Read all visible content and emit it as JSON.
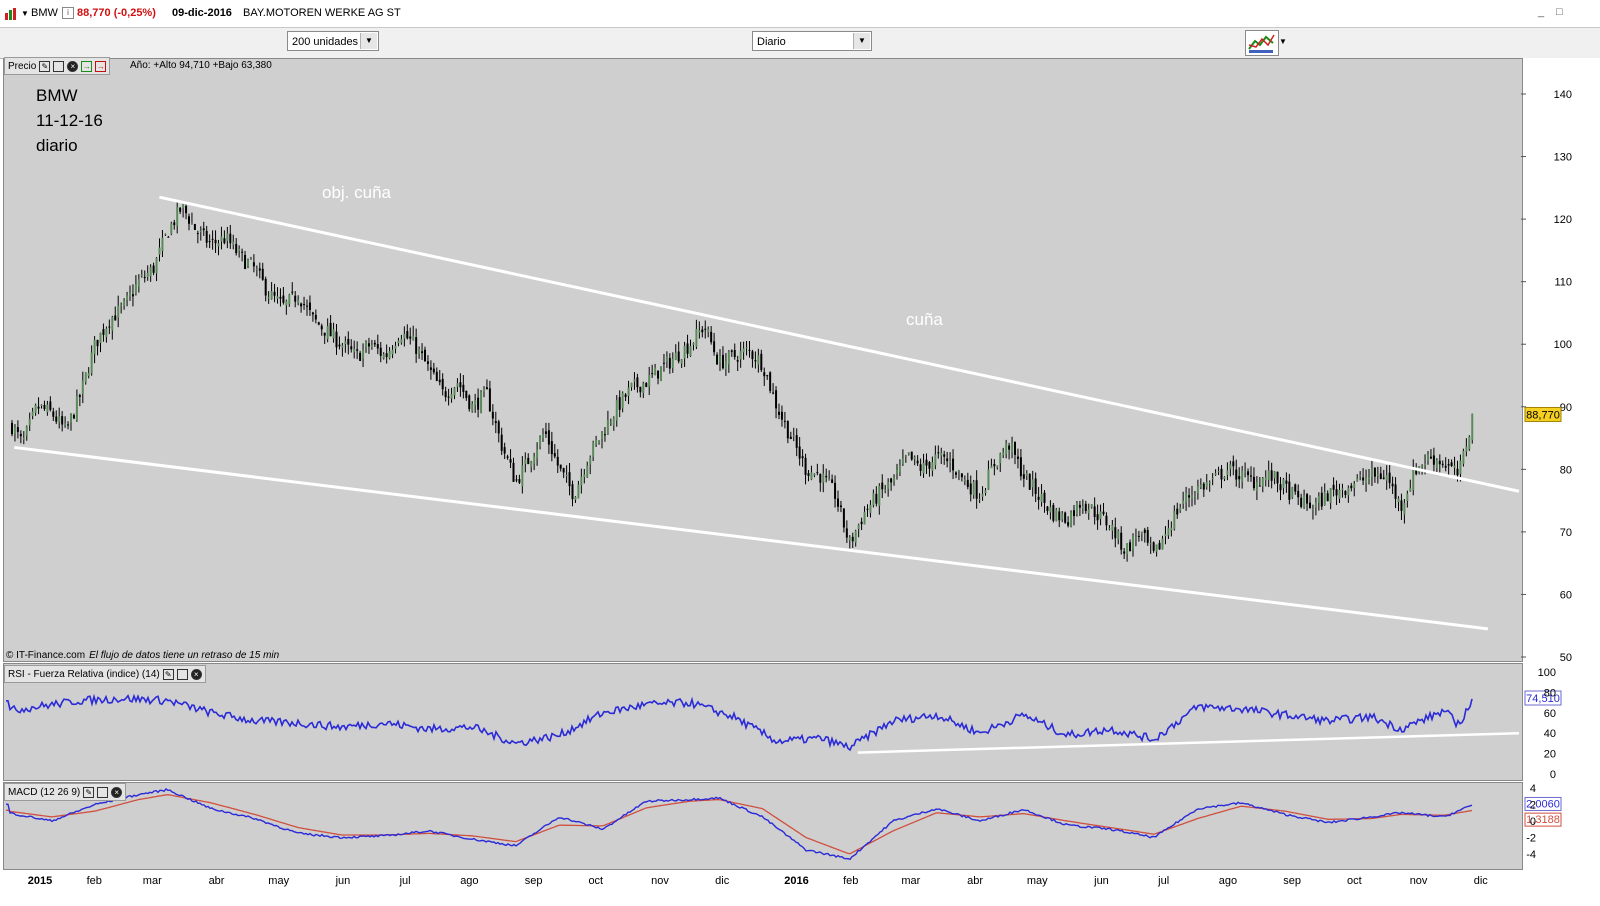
{
  "titlebar": {
    "symbol": "BMW",
    "info_icon": "i",
    "price": "88,770 (-0,25%)",
    "date": "09-dic-2016",
    "name": "BAY.MOTOREN WERKE AG ST",
    "minimize": "_",
    "maximize": "□"
  },
  "toolbar": {
    "units": "200 unidades",
    "period": "Diario"
  },
  "price_panel": {
    "label": "Precio",
    "year_info": "Año: +Alto 94,710 +Bajo 63,380",
    "credit_source": "© IT-Finance.com",
    "credit_note": "El flujo de datos tiene un retraso de 15 min",
    "annotation_lines": [
      "BMW",
      "11-12-16",
      "diario"
    ],
    "text_obj": "obj. cuña",
    "text_cuna": "cuña",
    "last_price_tag": "88,770"
  },
  "rsi_panel": {
    "label": "RSI - Fuerza Relativa (indice) (14)",
    "value_tag": "74,510"
  },
  "macd_panel": {
    "label": "MACD (12 26 9)",
    "macd_tag": "2,0060",
    "signal_tag": "1,3188"
  },
  "colors": {
    "panel_bg": "#cfcfcf",
    "candle": "#000000",
    "candle_up": "#5a8a5a",
    "trendline": "#ffffff",
    "rsi": "#2a2ad8",
    "macd": "#2a2ad8",
    "signal": "#d05040",
    "price_tag_bg": "#f5d020"
  },
  "chart_data": [
    {
      "type": "candlestick",
      "x_ticks": [
        "2015",
        "feb",
        "mar",
        "abr",
        "may",
        "jun",
        "jul",
        "ago",
        "sep",
        "oct",
        "nov",
        "dic",
        "2016",
        "feb",
        "mar",
        "abr",
        "may",
        "jun",
        "jul",
        "ago",
        "sep",
        "oct",
        "nov",
        "dic"
      ],
      "y_ticks": [
        140,
        130,
        120,
        110,
        100,
        90,
        80,
        70,
        60,
        50
      ],
      "ylim": [
        50,
        145
      ],
      "close_path": [
        [
          "2015-01-02",
          88
        ],
        [
          "2015-01-09",
          84
        ],
        [
          "2015-01-16",
          90
        ],
        [
          "2015-01-23",
          89
        ],
        [
          "2015-01-30",
          86
        ],
        [
          "2015-02-06",
          92
        ],
        [
          "2015-02-13",
          100
        ],
        [
          "2015-02-20",
          104
        ],
        [
          "2015-02-27",
          106
        ],
        [
          "2015-03-06",
          110
        ],
        [
          "2015-03-13",
          112
        ],
        [
          "2015-03-20",
          118
        ],
        [
          "2015-03-27",
          122
        ],
        [
          "2015-04-03",
          118
        ],
        [
          "2015-04-10",
          116
        ],
        [
          "2015-04-17",
          117
        ],
        [
          "2015-04-24",
          114
        ],
        [
          "2015-05-01",
          112
        ],
        [
          "2015-05-08",
          108
        ],
        [
          "2015-05-15",
          106
        ],
        [
          "2015-05-22",
          108
        ],
        [
          "2015-05-29",
          104
        ],
        [
          "2015-06-05",
          102
        ],
        [
          "2015-06-12",
          100
        ],
        [
          "2015-06-19",
          98
        ],
        [
          "2015-06-26",
          100
        ],
        [
          "2015-07-03",
          98
        ],
        [
          "2015-07-10",
          102
        ],
        [
          "2015-07-17",
          100
        ],
        [
          "2015-07-24",
          96
        ],
        [
          "2015-07-31",
          92
        ],
        [
          "2015-08-07",
          94
        ],
        [
          "2015-08-14",
          90
        ],
        [
          "2015-08-21",
          92
        ],
        [
          "2015-08-28",
          84
        ],
        [
          "2015-09-04",
          78
        ],
        [
          "2015-09-11",
          82
        ],
        [
          "2015-09-18",
          86
        ],
        [
          "2015-09-25",
          80
        ],
        [
          "2015-10-02",
          76
        ],
        [
          "2015-10-09",
          82
        ],
        [
          "2015-10-16",
          86
        ],
        [
          "2015-10-23",
          90
        ],
        [
          "2015-10-30",
          93
        ],
        [
          "2015-11-06",
          94
        ],
        [
          "2015-11-13",
          96
        ],
        [
          "2015-11-20",
          98
        ],
        [
          "2015-11-27",
          100
        ],
        [
          "2015-12-04",
          103
        ],
        [
          "2015-12-11",
          97
        ],
        [
          "2015-12-18",
          98
        ],
        [
          "2015-12-25",
          99
        ],
        [
          "2016-01-01",
          97
        ],
        [
          "2016-01-08",
          90
        ],
        [
          "2016-01-15",
          85
        ],
        [
          "2016-01-22",
          80
        ],
        [
          "2016-01-29",
          79
        ],
        [
          "2016-02-05",
          76
        ],
        [
          "2016-02-12",
          68
        ],
        [
          "2016-02-19",
          73
        ],
        [
          "2016-02-26",
          76
        ],
        [
          "2016-03-04",
          78
        ],
        [
          "2016-03-11",
          82
        ],
        [
          "2016-03-18",
          80
        ],
        [
          "2016-03-25",
          82
        ],
        [
          "2016-04-01",
          81
        ],
        [
          "2016-04-08",
          78
        ],
        [
          "2016-04-15",
          76
        ],
        [
          "2016-04-22",
          81
        ],
        [
          "2016-04-29",
          84
        ],
        [
          "2016-05-06",
          79
        ],
        [
          "2016-05-13",
          76
        ],
        [
          "2016-05-20",
          73
        ],
        [
          "2016-05-27",
          72
        ],
        [
          "2016-06-03",
          75
        ],
        [
          "2016-06-10",
          73
        ],
        [
          "2016-06-17",
          71
        ],
        [
          "2016-06-24",
          67
        ],
        [
          "2016-07-01",
          70
        ],
        [
          "2016-07-08",
          66
        ],
        [
          "2016-07-15",
          71
        ],
        [
          "2016-07-22",
          75
        ],
        [
          "2016-07-29",
          77
        ],
        [
          "2016-08-05",
          78
        ],
        [
          "2016-08-12",
          80
        ],
        [
          "2016-08-19",
          79
        ],
        [
          "2016-08-26",
          78
        ],
        [
          "2016-09-02",
          79
        ],
        [
          "2016-09-09",
          77
        ],
        [
          "2016-09-16",
          75
        ],
        [
          "2016-09-23",
          74
        ],
        [
          "2016-09-30",
          76
        ],
        [
          "2016-10-07",
          77
        ],
        [
          "2016-10-14",
          78
        ],
        [
          "2016-10-21",
          79
        ],
        [
          "2016-10-28",
          79
        ],
        [
          "2016-11-04",
          74
        ],
        [
          "2016-11-11",
          80
        ],
        [
          "2016-11-18",
          82
        ],
        [
          "2016-11-25",
          81
        ],
        [
          "2016-12-02",
          79
        ],
        [
          "2016-12-09",
          89
        ]
      ],
      "trendlines": [
        {
          "name": "upper",
          "from": [
            "2015-03-16",
            123.5
          ],
          "to": [
            "2016-12-31",
            76.5
          ]
        },
        {
          "name": "lower",
          "from": [
            "2015-01-05",
            83.5
          ],
          "to": [
            "2016-12-16",
            54.5
          ]
        }
      ]
    },
    {
      "type": "line",
      "y_ticks": [
        100,
        80,
        60,
        40,
        20,
        0
      ],
      "ylim": [
        0,
        100
      ],
      "rsi_path": [
        [
          "2015-01-02",
          62
        ],
        [
          "2015-01-16",
          66
        ],
        [
          "2015-02-06",
          72
        ],
        [
          "2015-02-27",
          74
        ],
        [
          "2015-03-20",
          72
        ],
        [
          "2015-04-10",
          60
        ],
        [
          "2015-05-01",
          52
        ],
        [
          "2015-05-22",
          50
        ],
        [
          "2015-06-12",
          46
        ],
        [
          "2015-07-03",
          50
        ],
        [
          "2015-07-24",
          44
        ],
        [
          "2015-08-14",
          46
        ],
        [
          "2015-09-04",
          30
        ],
        [
          "2015-09-25",
          38
        ],
        [
          "2015-10-16",
          60
        ],
        [
          "2015-11-06",
          68
        ],
        [
          "2015-11-27",
          70
        ],
        [
          "2015-12-18",
          56
        ],
        [
          "2016-01-08",
          32
        ],
        [
          "2016-01-29",
          35
        ],
        [
          "2016-02-12",
          26
        ],
        [
          "2016-03-04",
          52
        ],
        [
          "2016-03-25",
          58
        ],
        [
          "2016-04-15",
          40
        ],
        [
          "2016-05-06",
          58
        ],
        [
          "2016-05-27",
          38
        ],
        [
          "2016-06-17",
          44
        ],
        [
          "2016-07-08",
          34
        ],
        [
          "2016-07-29",
          66
        ],
        [
          "2016-08-19",
          64
        ],
        [
          "2016-09-09",
          58
        ],
        [
          "2016-09-30",
          52
        ],
        [
          "2016-10-21",
          56
        ],
        [
          "2016-11-04",
          44
        ],
        [
          "2016-11-25",
          62
        ],
        [
          "2016-12-02",
          48
        ],
        [
          "2016-12-09",
          74.5
        ]
      ],
      "trendline": {
        "from": [
          "2016-02-16",
          21
        ],
        "to": [
          "2016-12-31",
          40
        ]
      }
    },
    {
      "type": "line",
      "y_ticks": [
        4,
        2,
        0,
        -2,
        -4
      ],
      "ylim": [
        -5,
        4.5
      ],
      "macd_path": [
        [
          "2015-01-02",
          1
        ],
        [
          "2015-01-23",
          0
        ],
        [
          "2015-02-13",
          2
        ],
        [
          "2015-03-06",
          3.2
        ],
        [
          "2015-03-20",
          3.8
        ],
        [
          "2015-04-10",
          1.5
        ],
        [
          "2015-05-01",
          0.3
        ],
        [
          "2015-05-22",
          -1.5
        ],
        [
          "2015-06-12",
          -2
        ],
        [
          "2015-07-03",
          -1.8
        ],
        [
          "2015-07-24",
          -1.2
        ],
        [
          "2015-08-14",
          -2.2
        ],
        [
          "2015-09-04",
          -3
        ],
        [
          "2015-09-25",
          0.5
        ],
        [
          "2015-10-16",
          -1
        ],
        [
          "2015-11-06",
          2.4
        ],
        [
          "2015-11-27",
          2.6
        ],
        [
          "2015-12-11",
          2.8
        ],
        [
          "2016-01-01",
          0.5
        ],
        [
          "2016-01-22",
          -3.5
        ],
        [
          "2016-02-12",
          -4.6
        ],
        [
          "2016-03-04",
          0
        ],
        [
          "2016-03-25",
          1.5
        ],
        [
          "2016-04-15",
          0
        ],
        [
          "2016-05-06",
          1.4
        ],
        [
          "2016-05-27",
          -0.5
        ],
        [
          "2016-06-17",
          -1
        ],
        [
          "2016-07-08",
          -2
        ],
        [
          "2016-07-29",
          1.5
        ],
        [
          "2016-08-19",
          2.2
        ],
        [
          "2016-09-09",
          0.8
        ],
        [
          "2016-09-30",
          -0.2
        ],
        [
          "2016-10-21",
          0.5
        ],
        [
          "2016-11-04",
          1
        ],
        [
          "2016-11-25",
          0.5
        ],
        [
          "2016-12-09",
          2
        ]
      ],
      "signal_path": [
        [
          "2015-01-02",
          1.2
        ],
        [
          "2015-01-23",
          0.5
        ],
        [
          "2015-02-13",
          1.2
        ],
        [
          "2015-03-06",
          2.6
        ],
        [
          "2015-03-20",
          3.2
        ],
        [
          "2015-04-10",
          2.2
        ],
        [
          "2015-05-01",
          0.8
        ],
        [
          "2015-05-22",
          -0.8
        ],
        [
          "2015-06-12",
          -1.7
        ],
        [
          "2015-07-03",
          -1.7
        ],
        [
          "2015-07-24",
          -1.5
        ],
        [
          "2015-08-14",
          -1.8
        ],
        [
          "2015-09-04",
          -2.5
        ],
        [
          "2015-09-25",
          -0.5
        ],
        [
          "2015-10-16",
          -0.6
        ],
        [
          "2015-11-06",
          1.6
        ],
        [
          "2015-11-27",
          2.4
        ],
        [
          "2015-12-11",
          2.6
        ],
        [
          "2016-01-01",
          1.5
        ],
        [
          "2016-01-22",
          -2
        ],
        [
          "2016-02-12",
          -4
        ],
        [
          "2016-03-04",
          -1.2
        ],
        [
          "2016-03-25",
          1
        ],
        [
          "2016-04-15",
          0.5
        ],
        [
          "2016-05-06",
          0.9
        ],
        [
          "2016-05-27",
          0
        ],
        [
          "2016-06-17",
          -0.8
        ],
        [
          "2016-07-08",
          -1.6
        ],
        [
          "2016-07-29",
          0.3
        ],
        [
          "2016-08-19",
          1.8
        ],
        [
          "2016-09-09",
          1.2
        ],
        [
          "2016-09-30",
          0.2
        ],
        [
          "2016-10-21",
          0.3
        ],
        [
          "2016-11-04",
          0.8
        ],
        [
          "2016-11-25",
          0.7
        ],
        [
          "2016-12-09",
          1.3
        ]
      ]
    }
  ]
}
